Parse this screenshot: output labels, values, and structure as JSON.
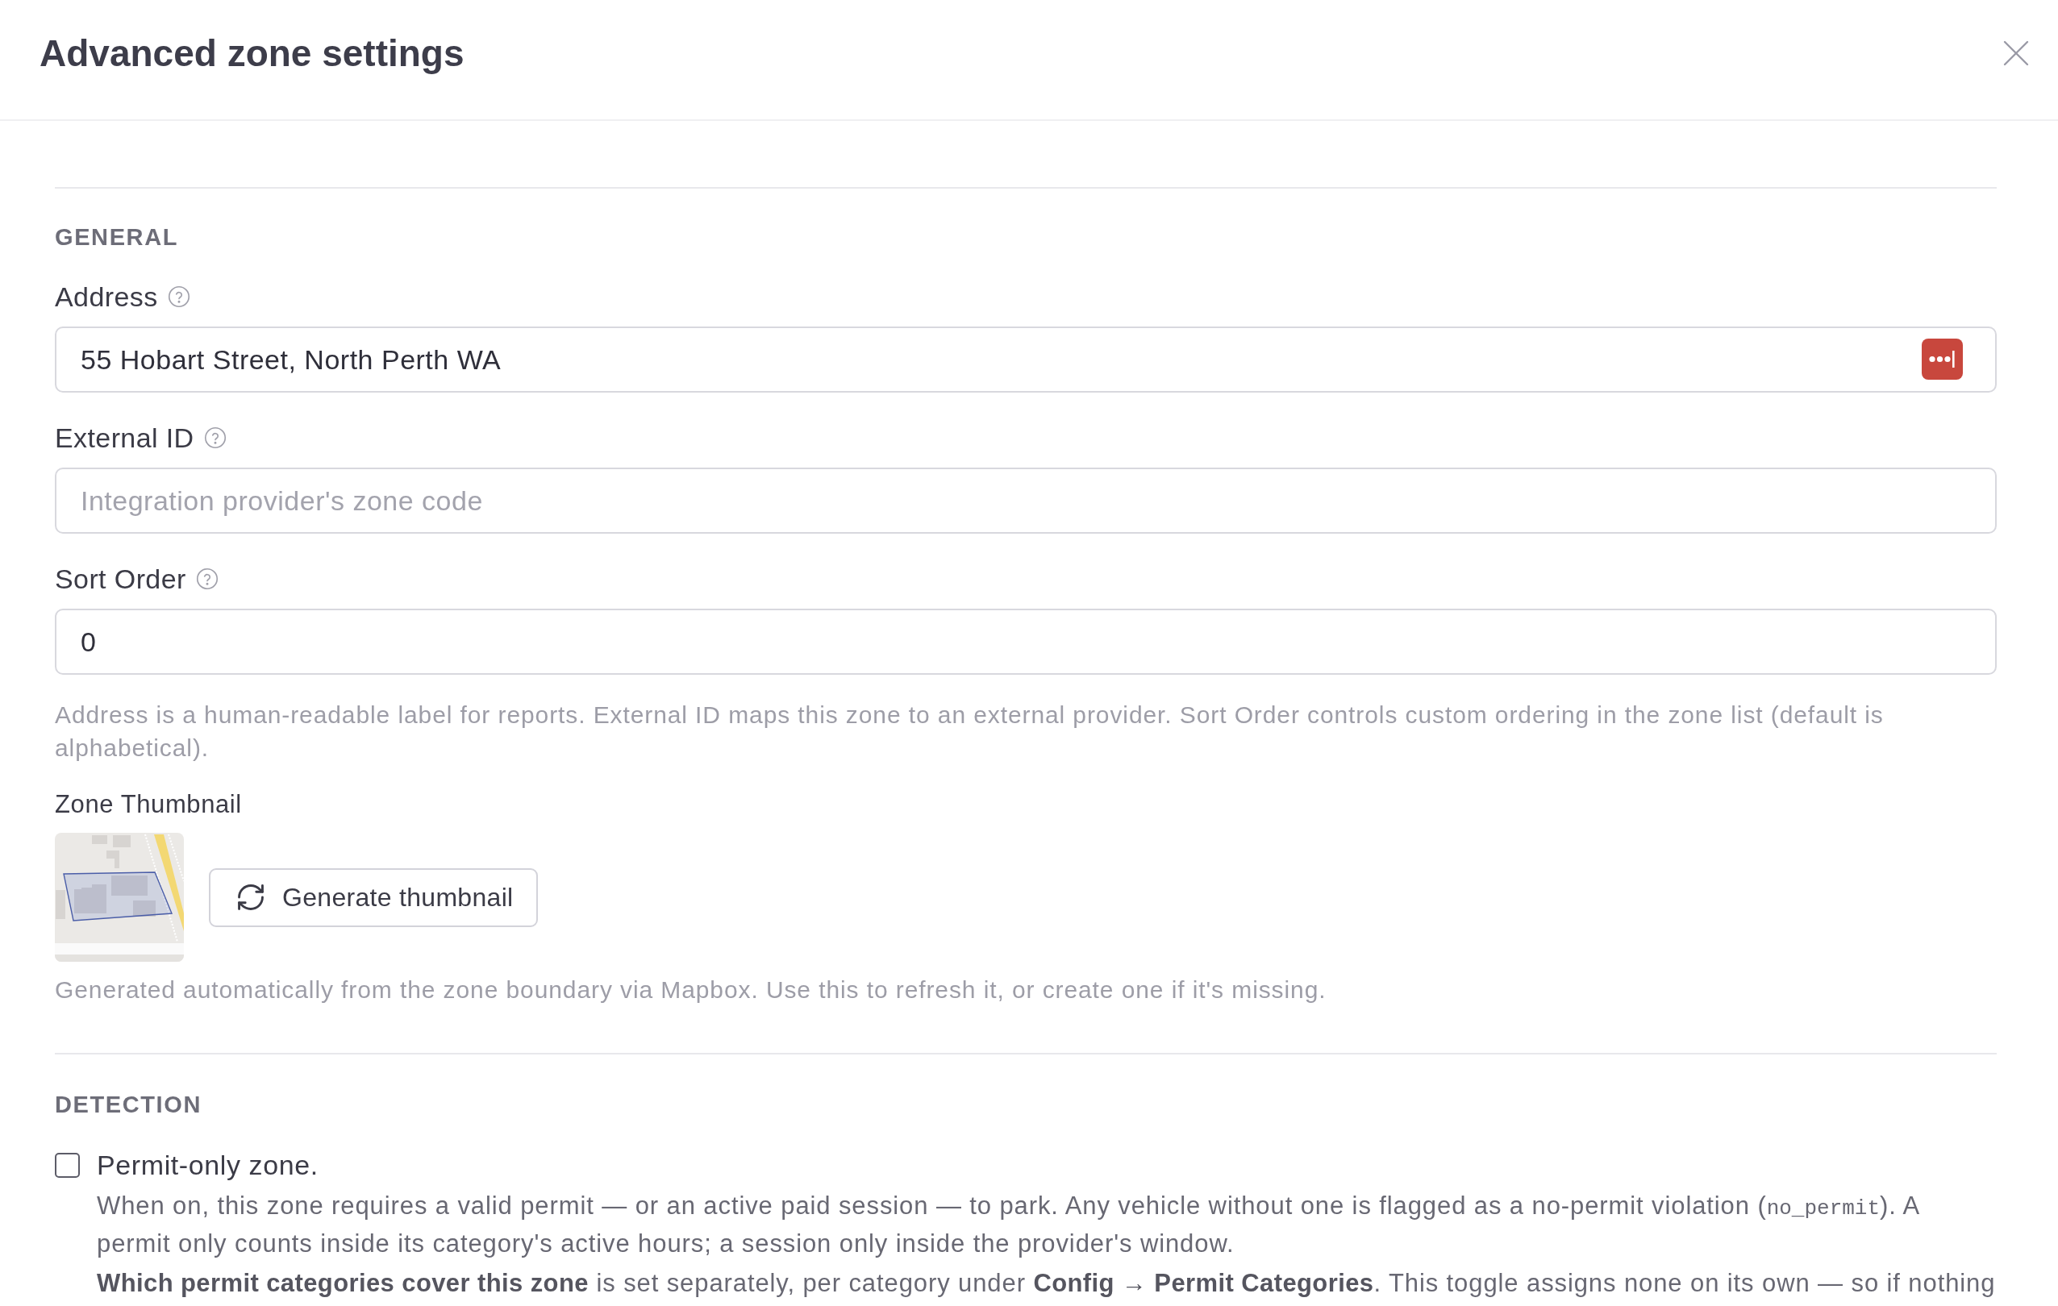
{
  "dialog": {
    "title": "Advanced zone settings"
  },
  "general": {
    "heading": "GENERAL",
    "fields": [
      {
        "label": "Address",
        "help": true,
        "value": "55 Hobart Street, North Perth WA",
        "autofill_icon": true
      },
      {
        "label": "External ID",
        "help": true,
        "placeholder": "Integration provider's zone code"
      },
      {
        "label": "Sort Order",
        "help": true,
        "value": "0"
      }
    ],
    "help_text": "Address is a human-readable label for reports. External ID maps this zone to an external provider. Sort Order controls custom ordering in the zone list (default is alphabetical).",
    "thumbnail": {
      "label": "Zone Thumbnail",
      "button": "Generate thumbnail",
      "help_text": "Generated automatically from the zone boundary via Mapbox. Use this to refresh it, or create one if it's missing."
    }
  },
  "detection": {
    "heading": "DETECTION",
    "options": [
      {
        "label": "Permit-only zone.",
        "checked": false,
        "description": [
          {
            "kind": "text",
            "text": "When on, this zone requires a valid permit — or an active paid session — to park. Any vehicle without one is flagged as a no-permit violation ("
          },
          {
            "kind": "code",
            "text": "no_permit"
          },
          {
            "kind": "text",
            "text": "). A permit only counts inside its category's active hours; a session only inside the provider's window."
          }
        ],
        "note": "**Which permit categories cover this zone** is set separately, per category under **Config → Permit Categories**. This toggle assigns none on its own — so if nothing"
      }
    ]
  }
}
